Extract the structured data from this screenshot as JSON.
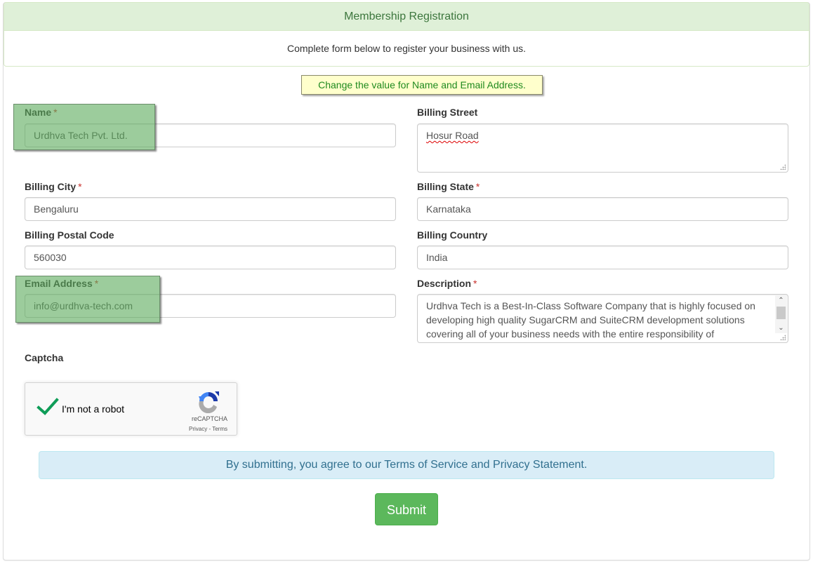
{
  "header": {
    "title": "Membership Registration",
    "subtitle": "Complete form below to register your business with us."
  },
  "annotation": {
    "note": "Change the value for Name and Email Address.",
    "highlight_color": "#5aaa5a"
  },
  "form": {
    "name": {
      "label": "Name",
      "required": "*",
      "value": "Urdhva Tech Pvt. Ltd."
    },
    "billing_street": {
      "label": "Billing Street",
      "value": "Hosur Road"
    },
    "billing_city": {
      "label": "Billing City",
      "required": "*",
      "value": "Bengaluru"
    },
    "billing_state": {
      "label": "Billing State",
      "required": "*",
      "value": "Karnataka"
    },
    "billing_postal_code": {
      "label": "Billing Postal Code",
      "value": "560030"
    },
    "billing_country": {
      "label": "Billing Country",
      "value": "India"
    },
    "email": {
      "label": "Email Address",
      "required": "*",
      "value": "info@urdhva-tech.com"
    },
    "description": {
      "label": "Description",
      "required": "*",
      "value": "Urdhva Tech is a Best-In-Class Software Company that is highly focused on developing high quality SugarCRM and SuiteCRM development solutions covering all of your business needs with the entire responsibility of"
    },
    "captcha": {
      "label": "Captcha",
      "checkbox_label": "I'm not a robot",
      "brand": "reCAPTCHA",
      "links": "Privacy - Terms",
      "checked": true
    }
  },
  "terms_notice": "By submitting, you agree to our Terms of Service and Privacy Statement.",
  "submit_label": "Submit",
  "colors": {
    "success_bg": "#dff0d8",
    "success_text": "#3c763d",
    "info_bg": "#d9edf7",
    "info_text": "#31708f",
    "button": "#5cb85c",
    "required": "#c9302c"
  }
}
